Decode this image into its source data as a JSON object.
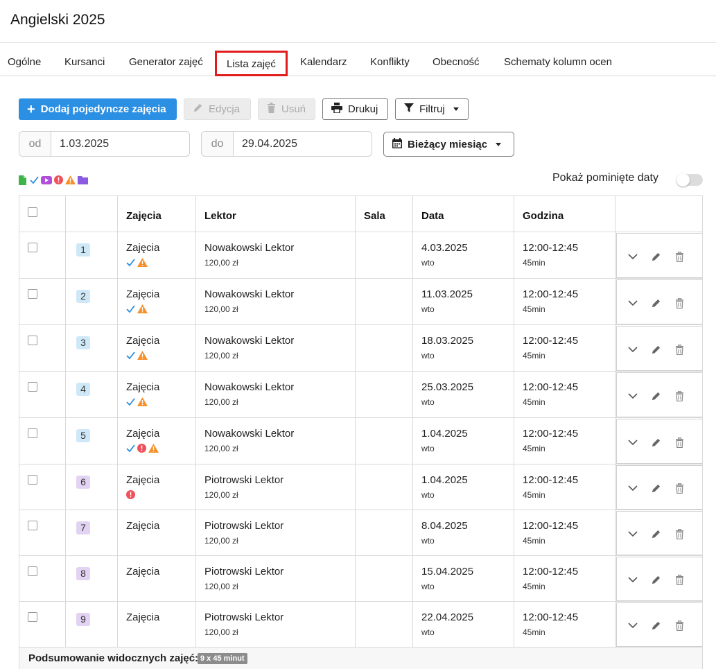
{
  "page": {
    "title": "Angielski 2025"
  },
  "tabs": [
    {
      "label": "Ogólne"
    },
    {
      "label": "Kursanci"
    },
    {
      "label": "Generator zajęć"
    },
    {
      "label": "Lista zajęć",
      "active": true
    },
    {
      "label": "Kalendarz"
    },
    {
      "label": "Konflikty"
    },
    {
      "label": "Obecność"
    },
    {
      "label": "Schematy kolumn ocen"
    }
  ],
  "toolbar": {
    "add_label": "Dodaj pojedyncze zajęcia",
    "edit_label": "Edycja",
    "delete_label": "Usuń",
    "print_label": "Drukuj",
    "filter_label": "Filtruj"
  },
  "date_filter": {
    "from_prefix": "od",
    "from_value": "1.03.2025",
    "to_prefix": "do",
    "to_value": "29.04.2025",
    "period_label": "Bieżący miesiąc"
  },
  "legend_icons": [
    "file-icon",
    "check-icon",
    "video-icon",
    "error-icon",
    "warning-icon",
    "folder-icon"
  ],
  "skipped_dates": {
    "label": "Pokaż pominięte daty",
    "enabled": false
  },
  "colors": {
    "primary": "#2b8fe3",
    "active_tab_border": "#e21b1b",
    "check": "#2b8fe3",
    "error": "#f0505a",
    "warning": "#f5902b",
    "badge_blue": "#cfe8f7",
    "badge_purple": "#e3d3f2"
  },
  "table": {
    "headers": [
      "",
      "",
      "Zajęcia",
      "Lektor",
      "Sala",
      "Data",
      "Godzina",
      ""
    ],
    "rows": [
      {
        "num": "1",
        "badge": "blue",
        "type": "Zajęcia",
        "icons": [
          "check",
          "warning"
        ],
        "lecturer": "Nowakowski Lektor",
        "price": "120,00 zł",
        "room": "",
        "date": "4.03.2025",
        "day": "wto",
        "time": "12:00-12:45",
        "duration": "45min"
      },
      {
        "num": "2",
        "badge": "blue",
        "type": "Zajęcia",
        "icons": [
          "check",
          "warning"
        ],
        "lecturer": "Nowakowski Lektor",
        "price": "120,00 zł",
        "room": "",
        "date": "11.03.2025",
        "day": "wto",
        "time": "12:00-12:45",
        "duration": "45min"
      },
      {
        "num": "3",
        "badge": "blue",
        "type": "Zajęcia",
        "icons": [
          "check",
          "warning"
        ],
        "lecturer": "Nowakowski Lektor",
        "price": "120,00 zł",
        "room": "",
        "date": "18.03.2025",
        "day": "wto",
        "time": "12:00-12:45",
        "duration": "45min"
      },
      {
        "num": "4",
        "badge": "blue",
        "type": "Zajęcia",
        "icons": [
          "check",
          "warning"
        ],
        "lecturer": "Nowakowski Lektor",
        "price": "120,00 zł",
        "room": "",
        "date": "25.03.2025",
        "day": "wto",
        "time": "12:00-12:45",
        "duration": "45min"
      },
      {
        "num": "5",
        "badge": "blue",
        "type": "Zajęcia",
        "icons": [
          "check",
          "error",
          "warning"
        ],
        "lecturer": "Nowakowski Lektor",
        "price": "120,00 zł",
        "room": "",
        "date": "1.04.2025",
        "day": "wto",
        "time": "12:00-12:45",
        "duration": "45min"
      },
      {
        "num": "6",
        "badge": "purple",
        "type": "Zajęcia",
        "icons": [
          "error"
        ],
        "lecturer": "Piotrowski Lektor",
        "price": "120,00 zł",
        "room": "",
        "date": "1.04.2025",
        "day": "wto",
        "time": "12:00-12:45",
        "duration": "45min"
      },
      {
        "num": "7",
        "badge": "purple",
        "type": "Zajęcia",
        "icons": [],
        "lecturer": "Piotrowski Lektor",
        "price": "120,00 zł",
        "room": "",
        "date": "8.04.2025",
        "day": "wto",
        "time": "12:00-12:45",
        "duration": "45min"
      },
      {
        "num": "8",
        "badge": "purple",
        "type": "Zajęcia",
        "icons": [],
        "lecturer": "Piotrowski Lektor",
        "price": "120,00 zł",
        "room": "",
        "date": "15.04.2025",
        "day": "wto",
        "time": "12:00-12:45",
        "duration": "45min"
      },
      {
        "num": "9",
        "badge": "purple",
        "type": "Zajęcia",
        "icons": [],
        "lecturer": "Piotrowski Lektor",
        "price": "120,00 zł",
        "room": "",
        "date": "22.04.2025",
        "day": "wto",
        "time": "12:00-12:45",
        "duration": "45min"
      }
    ]
  },
  "summary": {
    "label": "Podsumowanie widocznych zajęć:",
    "badge": "9 x 45 minut"
  }
}
